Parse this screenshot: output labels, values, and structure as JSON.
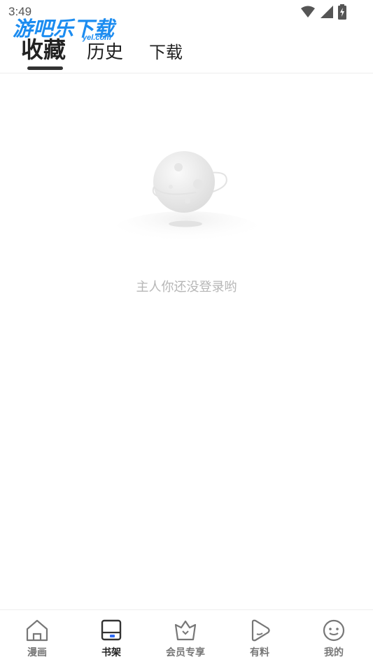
{
  "status_bar": {
    "time": "3:49",
    "icons": [
      "wifi-icon",
      "cell-signal-icon",
      "battery-charging-icon"
    ]
  },
  "watermark": {
    "title": "游吧乐下载",
    "subtitle": "yel.com"
  },
  "tabs": [
    {
      "label": "收藏",
      "active": true
    },
    {
      "label": "历史",
      "active": false
    },
    {
      "label": "下载",
      "active": false
    }
  ],
  "empty_state": {
    "illustration": "planet-icon",
    "message": "主人你还没登录哟"
  },
  "bottom_nav": {
    "items": [
      {
        "label": "漫画",
        "icon": "home-icon",
        "active": false
      },
      {
        "label": "书架",
        "icon": "bookshelf-icon",
        "active": true
      },
      {
        "label": "会员专享",
        "icon": "vip-crown-icon",
        "active": false
      },
      {
        "label": "有料",
        "icon": "play-icon",
        "active": false
      },
      {
        "label": "我的",
        "icon": "profile-icon",
        "active": false
      }
    ]
  },
  "colors": {
    "accent_blue": "#2f6bf6",
    "active_text": "#222222",
    "inactive_text": "#777777",
    "empty_text": "#b6b6b6"
  }
}
